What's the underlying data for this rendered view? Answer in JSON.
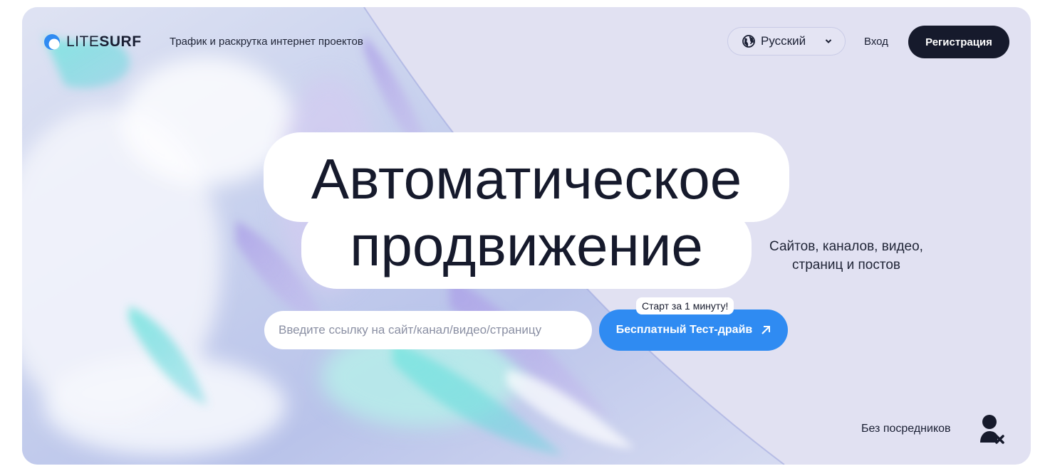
{
  "brand": {
    "name_light": "LITE",
    "name_bold": "SURF",
    "tagline": "Трафик и раскрутка интернет проектов"
  },
  "header": {
    "language_label": "Русский",
    "login_label": "Вход",
    "register_label": "Регистрация"
  },
  "hero": {
    "headline_line1": "Автоматическое",
    "headline_line2": "продвижение",
    "subline_1": "Сайтов, каналов, видео,",
    "subline_2": "страниц и постов",
    "url_placeholder": "Введите ссылку на сайт/канал/видео/страницу",
    "badge": "Старт за 1 минуту!",
    "cta_label": "Бесплатный Тест-драйв"
  },
  "footer_note": {
    "label": "Без посредников"
  },
  "icons": [
    "logo-icon",
    "globe-icon",
    "chevron-down-icon",
    "arrow-up-right-icon",
    "person-x-icon"
  ],
  "colors": {
    "background": "#e1e1f2",
    "dark": "#161a2c",
    "accent": "#2f8bf2"
  }
}
